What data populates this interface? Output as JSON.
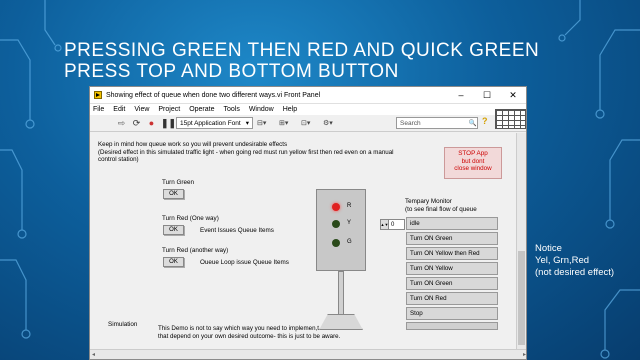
{
  "slide": {
    "title": "Pressing green then red and quick green press top and bottom button",
    "notice": [
      "Notice",
      "Yel, Grn,Red",
      "(not desired effect)"
    ]
  },
  "window": {
    "title": "Showing effect of queue when done two different ways.vi Front Panel",
    "controls": [
      "–",
      "☐",
      "✕"
    ],
    "menu": [
      "File",
      "Edit",
      "View",
      "Project",
      "Operate",
      "Tools",
      "Window",
      "Help"
    ],
    "toolbar": {
      "font": "15pt Application Font",
      "search_placeholder": "Search"
    }
  },
  "panel": {
    "intro_line1": "Keep in mind how queue work so you will prevent undesirable effects",
    "intro_line2": "(Desired effect in this simulated traffic light - when going red must run yellow first then red even on a manual",
    "intro_line3": "control station)",
    "stop_button": [
      "STOP App",
      "but dont",
      "close window"
    ],
    "turn_green_label": "Turn Green",
    "turn_red_one_label": "Turn Red (One way)",
    "turn_red_other_label": "Turn Red (another way)",
    "ok": "OK",
    "event_note": "Event Issues Queue Items",
    "queue_note": "Oueue Loop issue Queue Items",
    "lights": [
      {
        "label": "R",
        "color": "#e02020"
      },
      {
        "label": "Y",
        "color": "#2a4a1a"
      },
      {
        "label": "G",
        "color": "#2a4a1a"
      }
    ],
    "monitor_title_line1": "Tempary Monitor",
    "monitor_title_line2": "(to see final flow of queue",
    "index_value": "0",
    "queue_items": [
      "idle",
      "Turn ON Green",
      "Turn ON Yellow then Red",
      "Turn ON Yellow",
      "Turn ON Green",
      "Turn ON Red",
      "Stop",
      ""
    ],
    "simulation_label": "Simulation",
    "footer_line1": "This Demo is not to say which way you need to implemen,t",
    "footer_line2": "that depend on your own desired outcome- this is just to be aware."
  }
}
